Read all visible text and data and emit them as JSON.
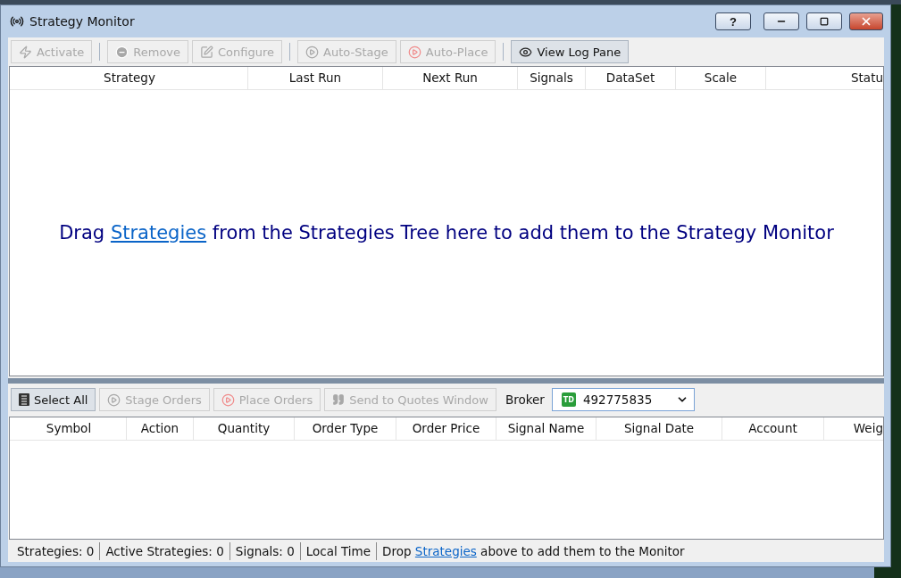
{
  "window": {
    "title": "Strategy Monitor",
    "controls": [
      {
        "kind": "help",
        "label": "?"
      },
      {
        "kind": "minimize"
      },
      {
        "kind": "maximize"
      },
      {
        "kind": "close"
      }
    ]
  },
  "toolbar": [
    {
      "kind": "bolt",
      "label": "Activate",
      "disabled": true
    },
    {
      "kind": "minus",
      "label": "Remove",
      "disabled": true
    },
    {
      "kind": "edit",
      "label": "Configure",
      "disabled": true
    },
    {
      "kind": "play",
      "label": "Auto-Stage",
      "disabled": true
    },
    {
      "kind": "play-red",
      "label": "Auto-Place",
      "disabled": true
    },
    {
      "kind": "eye",
      "label": "View Log Pane",
      "disabled": false
    }
  ],
  "strategies_table": {
    "columns": [
      "Strategy",
      "Last Run",
      "Next Run",
      "Signals",
      "DataSet",
      "Scale",
      "Statu"
    ],
    "empty_message": {
      "before": "Drag",
      "link": "Strategies",
      "after": "from the Strategies Tree here to add them to the Strategy Monitor"
    }
  },
  "orders_toolbar": [
    {
      "kind": "list",
      "label": "Select All",
      "disabled": false
    },
    {
      "kind": "play",
      "label": "Stage Orders",
      "disabled": true
    },
    {
      "kind": "play-red",
      "label": "Place Orders",
      "disabled": true
    },
    {
      "kind": "quote",
      "label": "Send to Quotes Window",
      "disabled": true
    }
  ],
  "broker": {
    "label": "Broker",
    "logo": "TD",
    "value": "492775835"
  },
  "orders_table": {
    "columns": [
      "Symbol",
      "Action",
      "Quantity",
      "Order Type",
      "Order Price",
      "Signal Name",
      "Signal Date",
      "Account",
      "Weig"
    ]
  },
  "status_bar": {
    "items": [
      "Strategies: 0",
      "Active Strategies: 0",
      "Signals: 0",
      "Local Time"
    ],
    "message": {
      "before": "Drop",
      "link": "Strategies",
      "after": "above to add them to the Monitor"
    }
  }
}
